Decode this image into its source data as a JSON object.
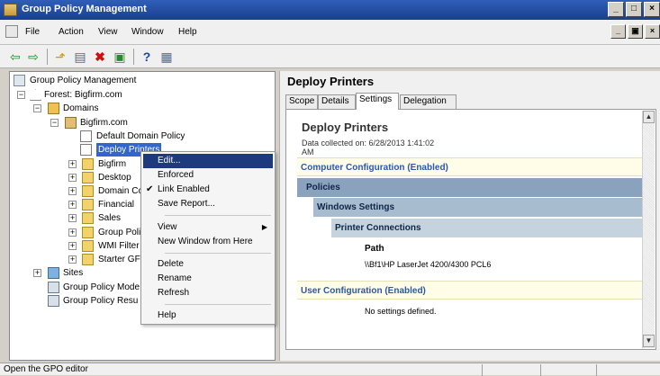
{
  "window": {
    "title": "Group Policy Management",
    "controls": [
      "_",
      "□",
      "×"
    ]
  },
  "menubar": {
    "items": [
      "File",
      "Action",
      "View",
      "Window",
      "Help"
    ],
    "mdi_controls": [
      "_",
      "▣",
      "×"
    ]
  },
  "toolbar": {
    "buttons": [
      "back-icon",
      "forward-icon",
      "up-icon",
      "show-hide-tree-icon",
      "delete-icon",
      "refresh-icon",
      "help-icon",
      "properties-icon"
    ]
  },
  "tree": {
    "root": "Group Policy Management",
    "forest": "Forest: Bigfirm.com",
    "domains": "Domains",
    "domain": "Bigfirm.com",
    "gpo_links": [
      "Default Domain Policy",
      "Deploy Printers"
    ],
    "ous": [
      "Bigfirm",
      "Desktop",
      "Domain Cc",
      "Financial",
      "Sales",
      "Group Poli",
      "WMI Filter",
      "Starter GF"
    ],
    "sites": "Sites",
    "modeling": "Group Policy Mode",
    "results": "Group Policy Resu"
  },
  "context_menu": {
    "items": [
      "Edit...",
      "Enforced",
      "Link Enabled",
      "Save Report...",
      "View",
      "New Window from Here",
      "Delete",
      "Rename",
      "Refresh",
      "Help"
    ],
    "highlighted": "Edit...",
    "checked": "Link Enabled"
  },
  "right_pane": {
    "title": "Deploy Printers",
    "tabs": [
      "Scope",
      "Details",
      "Settings",
      "Delegation"
    ],
    "active_tab": "Settings",
    "report": {
      "title": "Deploy Printers",
      "collected_label": "Data collected on: 6/28/2013 1:41:02",
      "collected_suffix": "AM",
      "computer_config": "Computer Configuration (Enabled)",
      "policies": "Policies",
      "windows_settings": "Windows Settings",
      "printer_connections": "Printer Connections",
      "path_header": "Path",
      "path_value": "\\\\Bf1\\HP LaserJet 4200/4300 PCL6",
      "user_config": "User Configuration (Enabled)",
      "no_settings": "No settings defined."
    }
  },
  "statusbar": {
    "text": "Open the GPO editor"
  }
}
